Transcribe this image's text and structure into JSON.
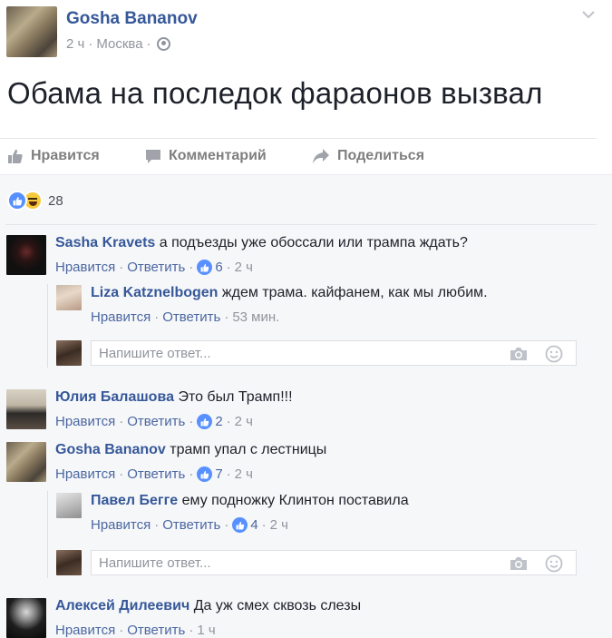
{
  "post": {
    "author": "Gosha Bananov",
    "time": "2 ч",
    "location": "Москва",
    "separator": "·",
    "text": "Обама на последок фараонов вызвал"
  },
  "actions": {
    "like": "Нравится",
    "comment": "Комментарий",
    "share": "Поделиться"
  },
  "reactions": {
    "count": "28"
  },
  "comments": [
    {
      "name": "Sasha Kravets",
      "text": "а подъезды уже обоссали или трампа ждать?",
      "like": "Нравится",
      "reply": "Ответить",
      "likes": "6",
      "time": "2 ч",
      "replies": [
        {
          "name": "Liza Katznelbogen",
          "text": "ждем трама. кайфанем, как мы любим.",
          "like": "Нравится",
          "reply": "Ответить",
          "time": "53 мин."
        }
      ]
    },
    {
      "name": "Юлия Балашова",
      "text": "Это был Трамп!!!",
      "like": "Нравится",
      "reply": "Ответить",
      "likes": "2",
      "time": "2 ч"
    },
    {
      "name": "Gosha Bananov",
      "text": "трамп упал с лестницы",
      "like": "Нравится",
      "reply": "Ответить",
      "likes": "7",
      "time": "2 ч",
      "replies": [
        {
          "name": "Павел Бегге",
          "text": "ему подножку Клинтон поставила",
          "like": "Нравится",
          "reply": "Ответить",
          "likes": "4",
          "time": "2 ч"
        }
      ]
    },
    {
      "name": "Алексей Дилеевич",
      "text": "Да уж смех сквозь слезы",
      "like": "Нравится",
      "reply": "Ответить",
      "time": "1 ч"
    }
  ],
  "reply_box": {
    "placeholder": "Напишите ответ..."
  },
  "icons": {
    "menu": "chevron-down-icon",
    "privacy": "globe-icon",
    "like": "thumbs-up-icon",
    "comment": "speech-bubble-icon",
    "share": "share-arrow-icon",
    "camera": "camera-icon",
    "emoji": "smiley-icon"
  },
  "colors": {
    "link": "#365899",
    "meta": "#90949c",
    "action": "#7f7f7f",
    "like_blue": "#5890ff",
    "feed_bg": "#f6f7f9"
  }
}
